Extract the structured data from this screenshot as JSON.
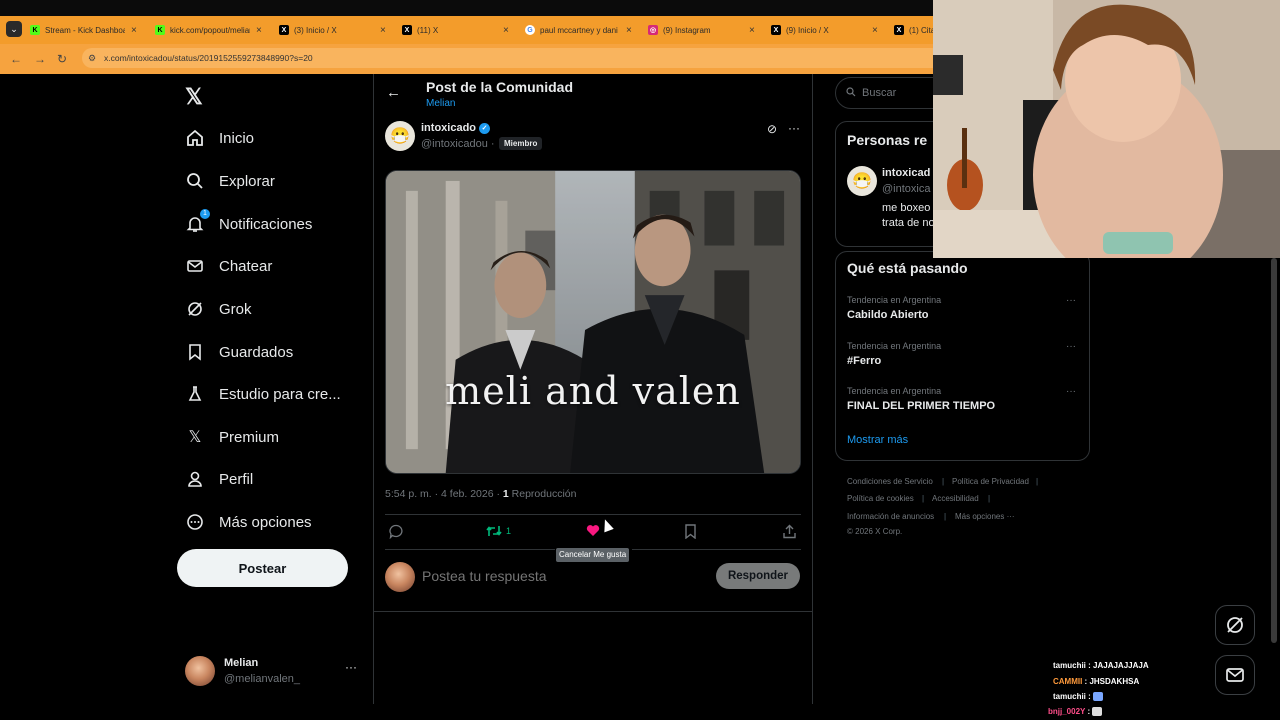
{
  "browser": {
    "tabs": [
      {
        "label": "Stream - Kick Dashboard",
        "favicon": "kick-icon"
      },
      {
        "label": "kick.com/popout/melian",
        "favicon": "kick-icon"
      },
      {
        "label": "(3) Inicio / X",
        "favicon": "x-icon"
      },
      {
        "label": "(11) X",
        "favicon": "x-icon"
      },
      {
        "label": "paul mccartney y dani",
        "favicon": "google-icon"
      },
      {
        "label": "(9) Instagram",
        "favicon": "instagram-icon"
      },
      {
        "label": "(9) Inicio / X",
        "favicon": "x-icon"
      },
      {
        "label": "(1) Cita",
        "favicon": "x-icon"
      }
    ],
    "url": "x.com/intoxicadou/status/2019152559273848990?s=20",
    "accent_color": "#f39c2b"
  },
  "nav": {
    "items": [
      {
        "label": "Inicio",
        "icon": "home-icon"
      },
      {
        "label": "Explorar",
        "icon": "search-icon"
      },
      {
        "label": "Notificaciones",
        "icon": "bell-icon",
        "badge": "1"
      },
      {
        "label": "Chatear",
        "icon": "mail-icon"
      },
      {
        "label": "Grok",
        "icon": "grok-icon"
      },
      {
        "label": "Guardados",
        "icon": "bookmark-icon"
      },
      {
        "label": "Estudio para cre...",
        "icon": "flask-icon"
      },
      {
        "label": "Premium",
        "icon": "x-icon"
      },
      {
        "label": "Perfil",
        "icon": "person-icon"
      },
      {
        "label": "Más opciones",
        "icon": "more-circle-icon"
      }
    ],
    "post_button": "Postear",
    "account": {
      "name": "Melian",
      "handle": "@melianvalen_"
    }
  },
  "post": {
    "header_title": "Post de la Comunidad",
    "community": "Melian",
    "author_name": "intoxicado",
    "author_handle": "@intoxicadou",
    "separator": "·",
    "member_tag": "Miembro",
    "image_caption": "meli and valen",
    "time": "5:54 p. m. · 4 feb. 2026 ·",
    "views_count": "1",
    "views_label": "Reproducción",
    "retweet_count": "1",
    "like_tooltip": "Cancelar Me gusta",
    "reply_placeholder": "Postea tu respuesta",
    "reply_button": "Responder"
  },
  "right": {
    "search_placeholder": "Buscar",
    "related_title": "Personas re",
    "related_user": {
      "name": "intoxicad",
      "handle": "@intoxica",
      "bio_line1": "me boxeo",
      "bio_line2": "trata de no"
    },
    "trending_title": "Qué está pasando",
    "trends": [
      {
        "meta": "Tendencia en Argentina",
        "name": "Cabildo Abierto"
      },
      {
        "meta": "Tendencia en Argentina",
        "name": "#Ferro"
      },
      {
        "meta": "Tendencia en Argentina",
        "name": "FINAL DEL PRIMER TIEMPO"
      }
    ],
    "show_more": "Mostrar más",
    "footer": {
      "terms": "Condiciones de Servicio",
      "privacy": "Política de Privacidad",
      "cookies": "Política de cookies",
      "accessibility": "Accesibilidad",
      "ads": "Información de anuncios",
      "more": "Más opciones ···",
      "copyright": "© 2026 X Corp."
    }
  },
  "chat": [
    {
      "user": "tamuchii",
      "message": "JAJAJAJJAJA"
    },
    {
      "user": "CAMMII",
      "message": "JHSDAKHSA"
    },
    {
      "user": "tamuchii",
      "message": ""
    },
    {
      "user": "bnjj_002Y",
      "message": ""
    }
  ]
}
